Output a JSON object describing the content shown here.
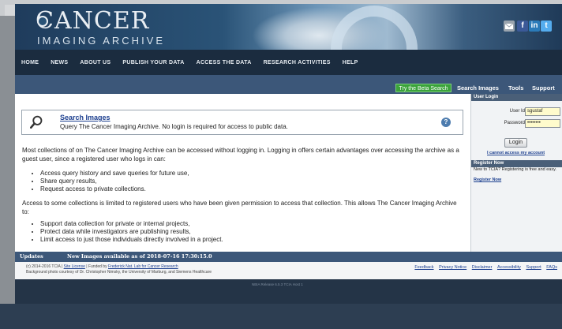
{
  "header": {
    "logo_main": "CANCER",
    "logo_sub": "IMAGING ARCHIVE",
    "social": [
      "mail-icon",
      "facebook-icon",
      "linkedin-icon",
      "twitter-icon"
    ],
    "social_labels": {
      "fb": "f",
      "li": "in",
      "tw": "t"
    }
  },
  "topnav": [
    "HOME",
    "NEWS",
    "ABOUT US",
    "PUBLISH YOUR DATA",
    "ACCESS THE DATA",
    "RESEARCH ACTIVITIES",
    "HELP"
  ],
  "subnav": {
    "beta": "Try the Beta Search",
    "items": [
      "Search Images",
      "Tools",
      "Support"
    ]
  },
  "search_box": {
    "title": "Search Images",
    "description": "Query The Cancer Imaging Archive. No login is required for access to public data.",
    "help": "?"
  },
  "content": {
    "para1": "Most collections of on The Cancer Imaging Archive can be accessed without logging in. Logging in offers certain advantages over accessing the archive as a guest user, since a registered user who logs in can:",
    "list1": [
      "Access query history and save queries for future use,",
      "Share query results,",
      "Request access to private collections."
    ],
    "para2": "Access to some collections is limited to registered users who have been given permission to access that collection. This allows The Cancer Imaging Archive to:",
    "list2": [
      "Support data collection for private or internal projects,",
      "Protect data while investigators are publishing results,",
      "Limit access to just those individuals directly involved in a project."
    ]
  },
  "login": {
    "header": "User Login",
    "user_label": "User Id",
    "user_value": "sgustaf",
    "password_label": "Password",
    "password_value": "••••••••",
    "button": "Login",
    "cant_access": "I cannot access my account"
  },
  "register": {
    "header": "Register Now",
    "text": "New to TCIA? Registering is free and easy.",
    "link": "Register Now"
  },
  "updates": {
    "label": "Updates",
    "text": "New Images available as of 2018-07-16 17:30:15.0"
  },
  "footer": {
    "line1_prefix": "(c) 2014-2016 TCIA |",
    "site_license": "Site License",
    "line1_mid": "| Funded by",
    "funder": "Frederick Nat. Lab for Cancer Research",
    "line2": "Background photo courtesy of Dr. Christopher Nimsky, the University of Marburg, and Siemens Healthcare",
    "links": [
      "Feedback",
      "Privacy Notice",
      "Disclaimer",
      "Accessibility",
      "Support",
      "FAQs"
    ]
  },
  "release": "NBIA Release 6.5.3 TCIA Host 1"
}
